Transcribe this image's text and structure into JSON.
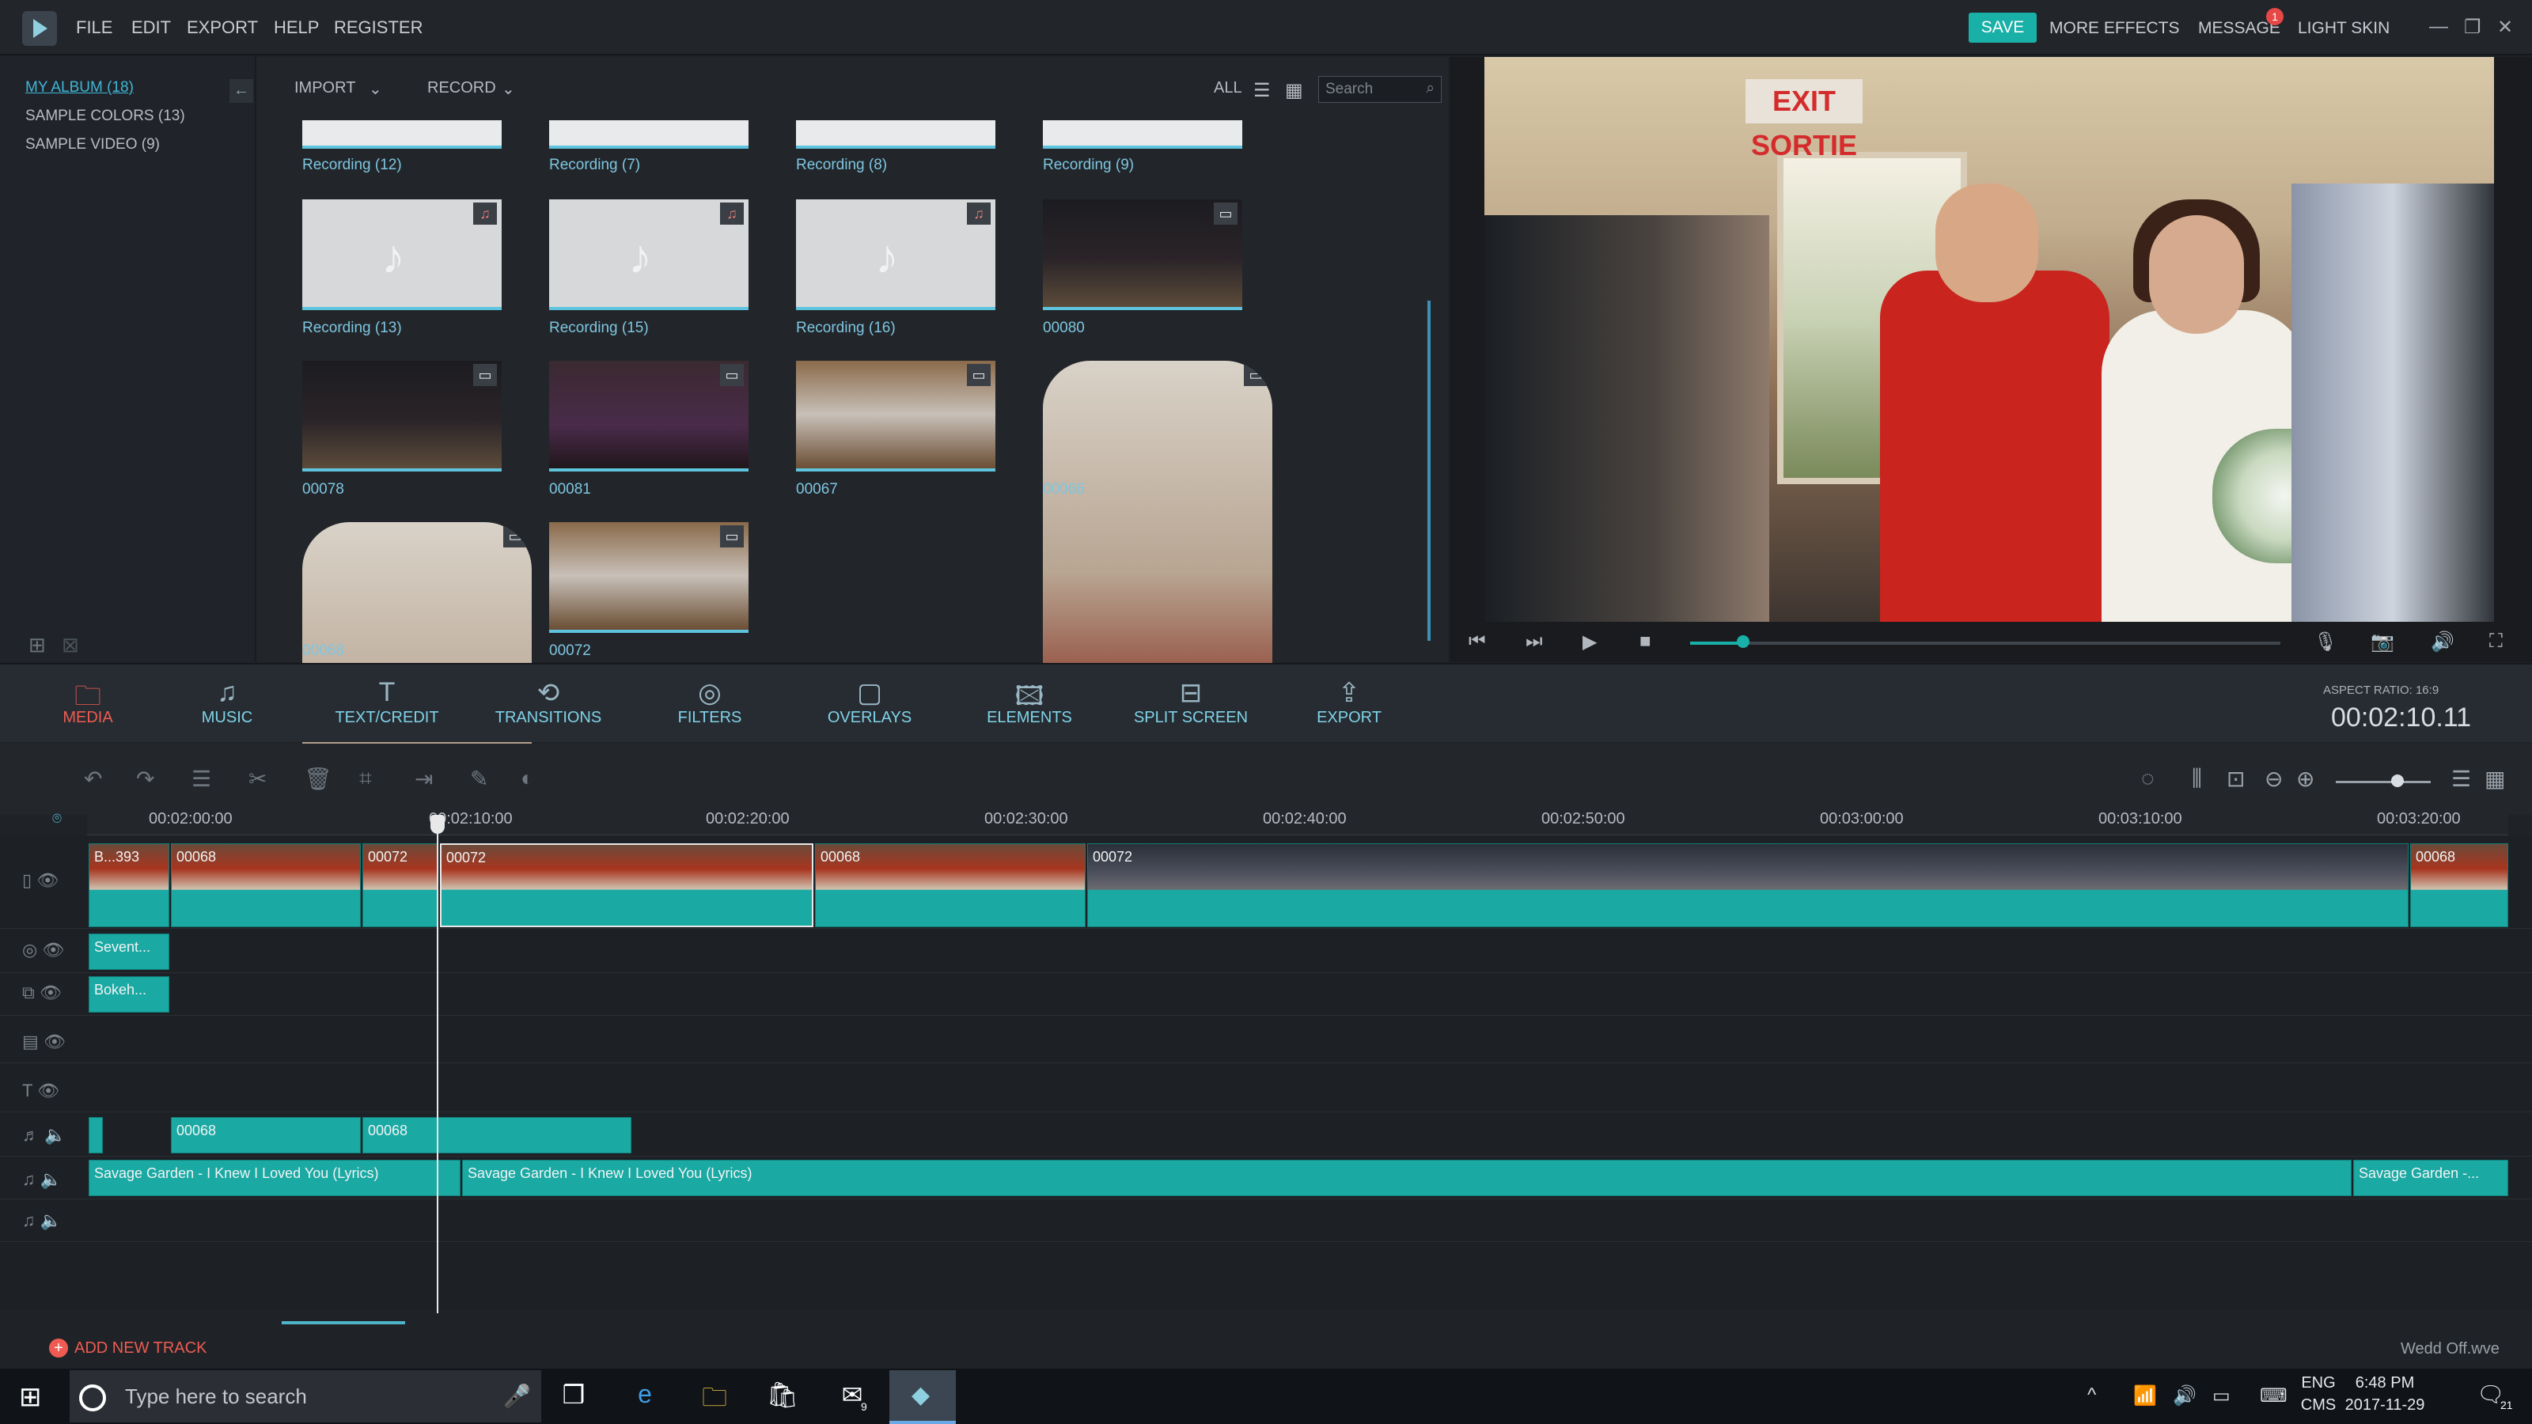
{
  "menubar": {
    "items": [
      "FILE",
      "EDIT",
      "EXPORT",
      "HELP",
      "REGISTER"
    ],
    "save": "SAVE",
    "more_effects": "MORE EFFECTS",
    "message": "MESSAGE",
    "message_badge": "1",
    "skin": "LIGHT SKIN",
    "accent": "#19b0a7"
  },
  "albums": [
    {
      "label": "MY ALBUM (18)",
      "active": true
    },
    {
      "label": "SAMPLE COLORS (13)",
      "active": false
    },
    {
      "label": "SAMPLE VIDEO (9)",
      "active": false
    }
  ],
  "library": {
    "import": "IMPORT",
    "record": "RECORD",
    "all": "ALL",
    "search_placeholder": "Search",
    "items": [
      {
        "label": "Recording (12)",
        "kind": "audio"
      },
      {
        "label": "Recording (7)",
        "kind": "audio"
      },
      {
        "label": "Recording (8)",
        "kind": "audio"
      },
      {
        "label": "Recording (9)",
        "kind": "audio"
      },
      {
        "label": "Recording (13)",
        "kind": "audio"
      },
      {
        "label": "Recording (15)",
        "kind": "audio"
      },
      {
        "label": "Recording (16)",
        "kind": "audio"
      },
      {
        "label": "00080",
        "kind": "video"
      },
      {
        "label": "00078",
        "kind": "video"
      },
      {
        "label": "00081",
        "kind": "video"
      },
      {
        "label": "00067",
        "kind": "video"
      },
      {
        "label": "00066",
        "kind": "video"
      },
      {
        "label": "00068",
        "kind": "video"
      },
      {
        "label": "00072",
        "kind": "video"
      }
    ]
  },
  "preview": {
    "sign_text": "EXIT SORTIE",
    "aspect_ratio": "ASPECT RATIO: 16:9",
    "timecode": "00:02:10.11",
    "progress": 0.09
  },
  "tabs": [
    {
      "label": "MEDIA",
      "icon": "folder-icon",
      "active": true
    },
    {
      "label": "MUSIC",
      "icon": "music-note-icon"
    },
    {
      "label": "TEXT/CREDIT",
      "icon": "text-icon"
    },
    {
      "label": "TRANSITIONS",
      "icon": "transition-icon"
    },
    {
      "label": "FILTERS",
      "icon": "filter-icon"
    },
    {
      "label": "OVERLAYS",
      "icon": "overlay-icon"
    },
    {
      "label": "ELEMENTS",
      "icon": "image-icon"
    },
    {
      "label": "SPLIT SCREEN",
      "icon": "split-screen-icon"
    },
    {
      "label": "EXPORT",
      "icon": "export-icon"
    }
  ],
  "ruler": [
    "00:02:00:00",
    "00:02:10:00",
    "00:02:20:00",
    "00:02:30:00",
    "00:02:40:00",
    "00:02:50:00",
    "00:03:00:00",
    "00:03:10:00",
    "00:03:20:00"
  ],
  "timeline": {
    "video_clips": [
      "B...393",
      "00068",
      "00072",
      "00072",
      "00068",
      "00072",
      "00068"
    ],
    "filter_clip": "Sevent...",
    "overlay_clip": "Bokeh...",
    "audio1_clips": [
      "00068",
      "00068"
    ],
    "music_clips": [
      "Savage Garden - I Knew I Loved You (Lyrics)",
      "Savage Garden - I Knew I Loved You (Lyrics)",
      "Savage Garden -..."
    ],
    "add_track": "ADD NEW TRACK",
    "project_name": "Wedd Off.wve"
  },
  "taskbar": {
    "search_placeholder": "Type here to search",
    "lang1": "ENG",
    "lang2": "CMS",
    "time": "6:48 PM",
    "date": "2017-11-29",
    "mail_badge": "9",
    "notif_count": "21"
  }
}
